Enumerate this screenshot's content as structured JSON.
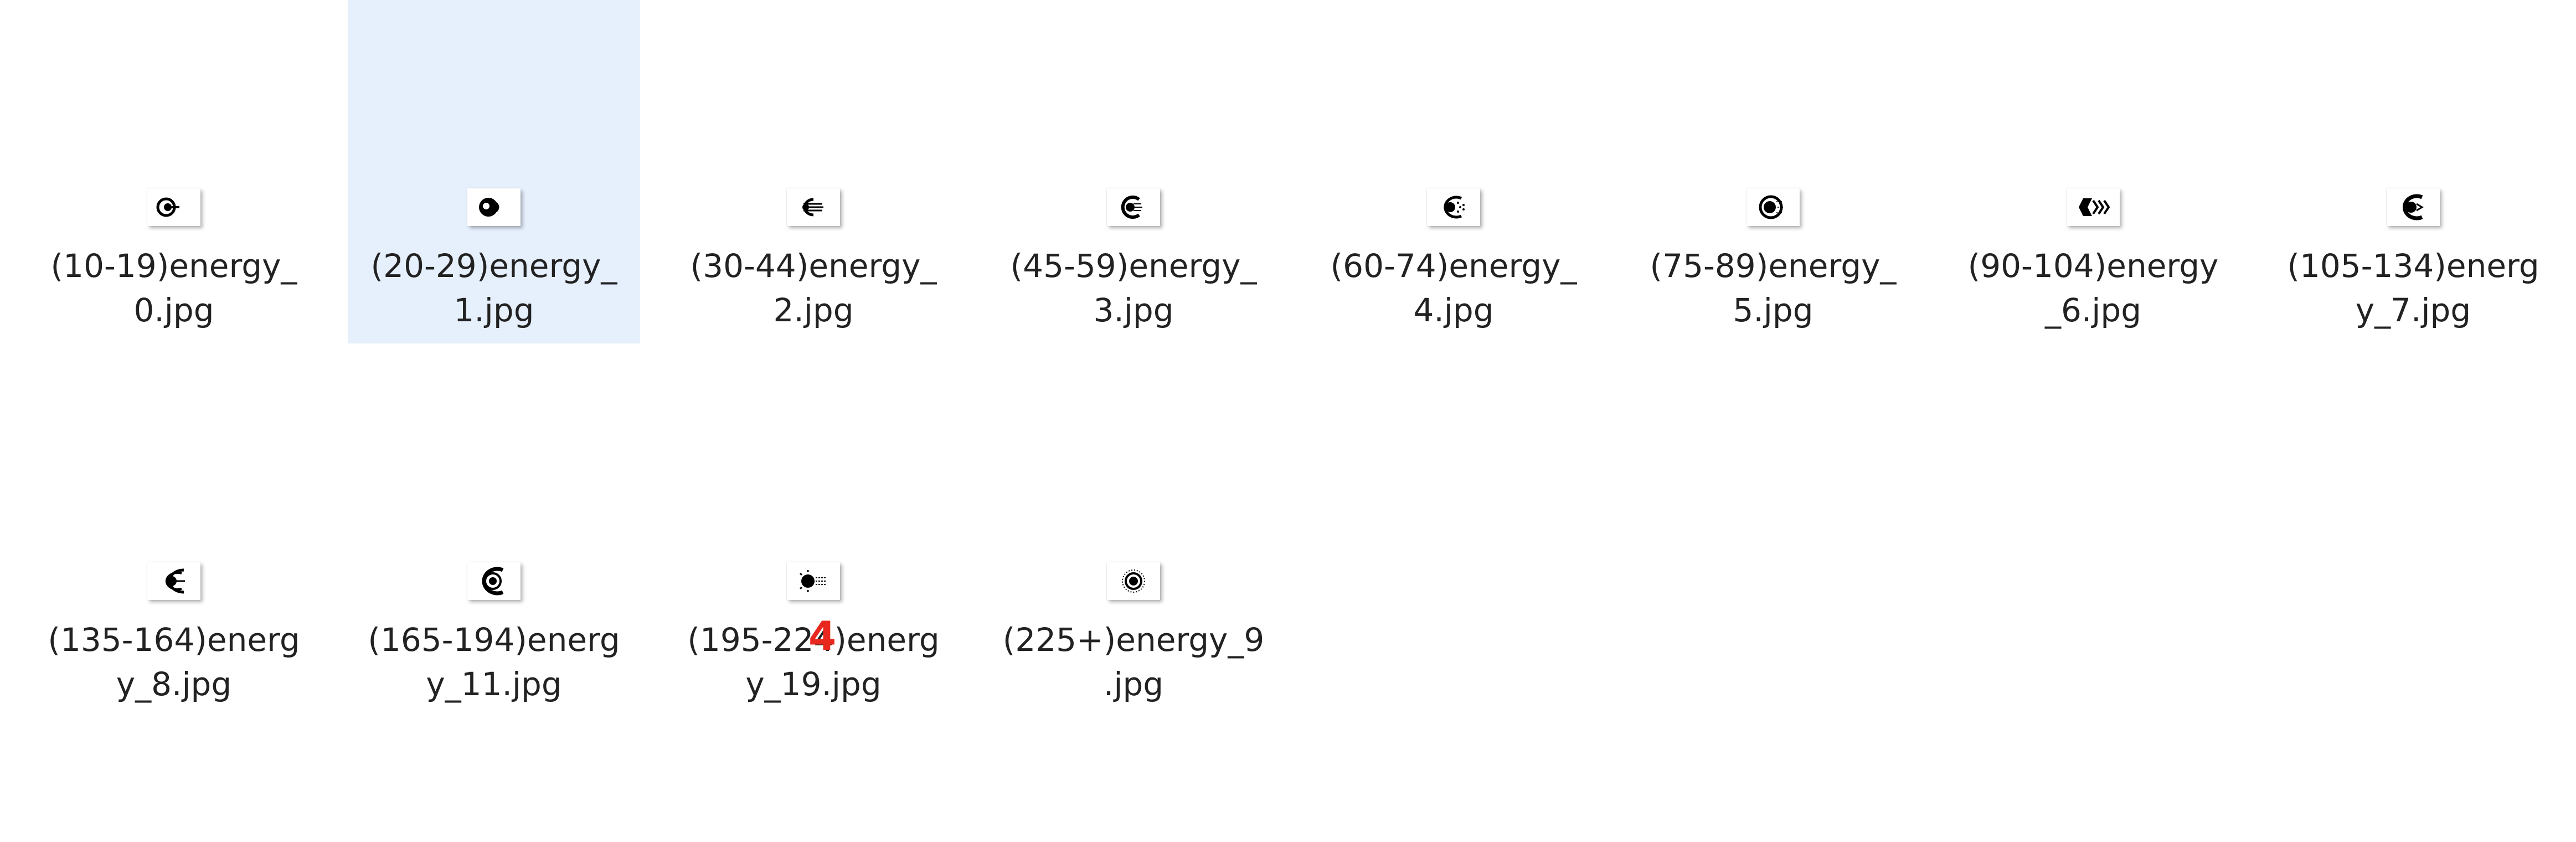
{
  "files": [
    {
      "name_line1": "(10-19)energy_",
      "name_line2": "0.jpg",
      "icon": "energy-icon-0",
      "selected": false
    },
    {
      "name_line1": "(20-29)energy_",
      "name_line2": "1.jpg",
      "icon": "energy-icon-1",
      "selected": true
    },
    {
      "name_line1": "(30-44)energy_",
      "name_line2": "2.jpg",
      "icon": "energy-icon-2",
      "selected": false
    },
    {
      "name_line1": "(45-59)energy_",
      "name_line2": "3.jpg",
      "icon": "energy-icon-3",
      "selected": false
    },
    {
      "name_line1": "(60-74)energy_",
      "name_line2": "4.jpg",
      "icon": "energy-icon-4",
      "selected": false
    },
    {
      "name_line1": "(75-89)energy_",
      "name_line2": "5.jpg",
      "icon": "energy-icon-5",
      "selected": false
    },
    {
      "name_line1": "(90-104)energy",
      "name_line2": "_6.jpg",
      "icon": "energy-icon-6",
      "selected": false
    },
    {
      "name_line1": "(105-134)energ",
      "name_line2": "y_7.jpg",
      "icon": "energy-icon-7",
      "selected": false
    },
    {
      "name_line1": "(135-164)energ",
      "name_line2": "y_8.jpg",
      "icon": "energy-icon-8",
      "selected": false
    },
    {
      "name_line1": "(165-194)energ",
      "name_line2": "y_11.jpg",
      "icon": "energy-icon-11",
      "selected": false
    },
    {
      "name_line1": "(195-224)energ",
      "name_line2": "y_19.jpg",
      "icon": "energy-icon-19",
      "selected": false
    },
    {
      "name_line1": "(225+)energy_9",
      "name_line2": ".jpg",
      "icon": "energy-icon-9",
      "selected": false
    }
  ],
  "annotation": {
    "text": "4",
    "color": "#e8281e"
  },
  "colors": {
    "selection": "#e6f0fd",
    "text": "#222222",
    "icon": "#000000"
  }
}
